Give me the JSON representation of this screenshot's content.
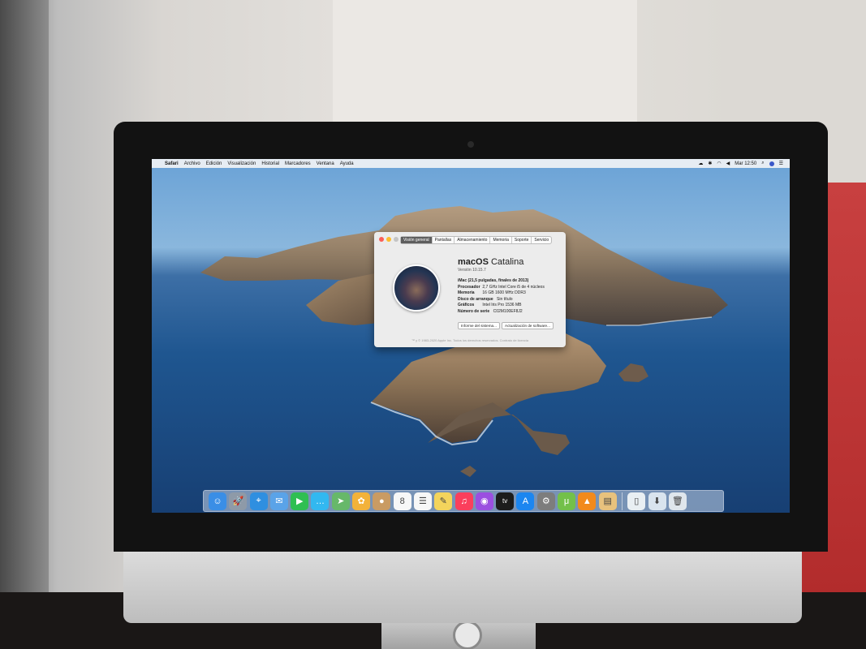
{
  "menubar": {
    "apple_symbol": "",
    "app": "Safari",
    "items": [
      "Archivo",
      "Edición",
      "Visualización",
      "Historial",
      "Marcadores",
      "Ventana",
      "Ayuda"
    ],
    "clock": "Mar 12:50"
  },
  "about_window": {
    "tabs": [
      "Visión general",
      "Pantallas",
      "Almacenamiento",
      "Memoria",
      "Soporte",
      "Servicio"
    ],
    "active_tab": "Visión general",
    "os_name": "macOS",
    "os_release": "Catalina",
    "version": "Versión 10.15.7",
    "model": "iMac (21,5 pulgadas, finales de 2013)",
    "specs": [
      {
        "label": "Procesador",
        "value": "2,7 GHz Intel Core i5 de 4 núcleos"
      },
      {
        "label": "Memoria",
        "value": "16 GB 1600 MHz DDR3"
      },
      {
        "label": "Disco de arranque",
        "value": "Sin título"
      },
      {
        "label": "Gráficos",
        "value": "Intel Iris Pro 1536 MB"
      },
      {
        "label": "Número de serie",
        "value": "C02M100EF8J2"
      }
    ],
    "buttons": {
      "system_report": "Informe del sistema...",
      "software_update": "Actualización de software..."
    },
    "footer": "™ y © 1983-2020 Apple Inc. Todos los derechos reservados. Contrato de licencia"
  },
  "dock": {
    "apps": [
      {
        "name": "finder-icon",
        "glyph": "☺",
        "color": "#3a8ee6"
      },
      {
        "name": "launchpad-icon",
        "glyph": "🚀",
        "color": "#8e9aa8"
      },
      {
        "name": "safari-icon",
        "glyph": "⌖",
        "color": "#2f8fe0"
      },
      {
        "name": "mail-icon",
        "glyph": "✉",
        "color": "#5aa3e8"
      },
      {
        "name": "facetime-icon",
        "glyph": "▶",
        "color": "#2fbf52"
      },
      {
        "name": "messages-icon",
        "glyph": "…",
        "color": "#32b8f0"
      },
      {
        "name": "maps-icon",
        "glyph": "➤",
        "color": "#67b86a"
      },
      {
        "name": "photos-icon",
        "glyph": "✿",
        "color": "#f3b23a"
      },
      {
        "name": "contacts-icon",
        "glyph": "●",
        "color": "#c99b63"
      },
      {
        "name": "calendar-icon",
        "glyph": "8",
        "color": "#f7f7f7"
      },
      {
        "name": "reminders-icon",
        "glyph": "☰",
        "color": "#f7f7f7"
      },
      {
        "name": "notes-icon",
        "glyph": "✎",
        "color": "#f3d45c"
      },
      {
        "name": "music-icon",
        "glyph": "♫",
        "color": "#fa3f5c"
      },
      {
        "name": "podcasts-icon",
        "glyph": "◉",
        "color": "#9b4fe0"
      },
      {
        "name": "apple-tv-icon",
        "glyph": "tv",
        "color": "#1c1c1c"
      },
      {
        "name": "app-store-icon",
        "glyph": "A",
        "color": "#1c86f0"
      },
      {
        "name": "system-preferences-icon",
        "glyph": "⚙",
        "color": "#7d7d7d"
      },
      {
        "name": "utorrent-icon",
        "glyph": "μ",
        "color": "#73c04a"
      },
      {
        "name": "vlc-icon",
        "glyph": "▲",
        "color": "#f28a1c"
      },
      {
        "name": "archive-utility-icon",
        "glyph": "▤",
        "color": "#e8c27d"
      }
    ],
    "right_items": [
      {
        "name": "torrent-file-icon",
        "glyph": "▯",
        "color": "#e9eff3"
      },
      {
        "name": "downloads-icon",
        "glyph": "⬇",
        "color": "#d9e4ee"
      },
      {
        "name": "trash-icon",
        "glyph": "🗑",
        "color": "#dfe6ec"
      }
    ]
  }
}
